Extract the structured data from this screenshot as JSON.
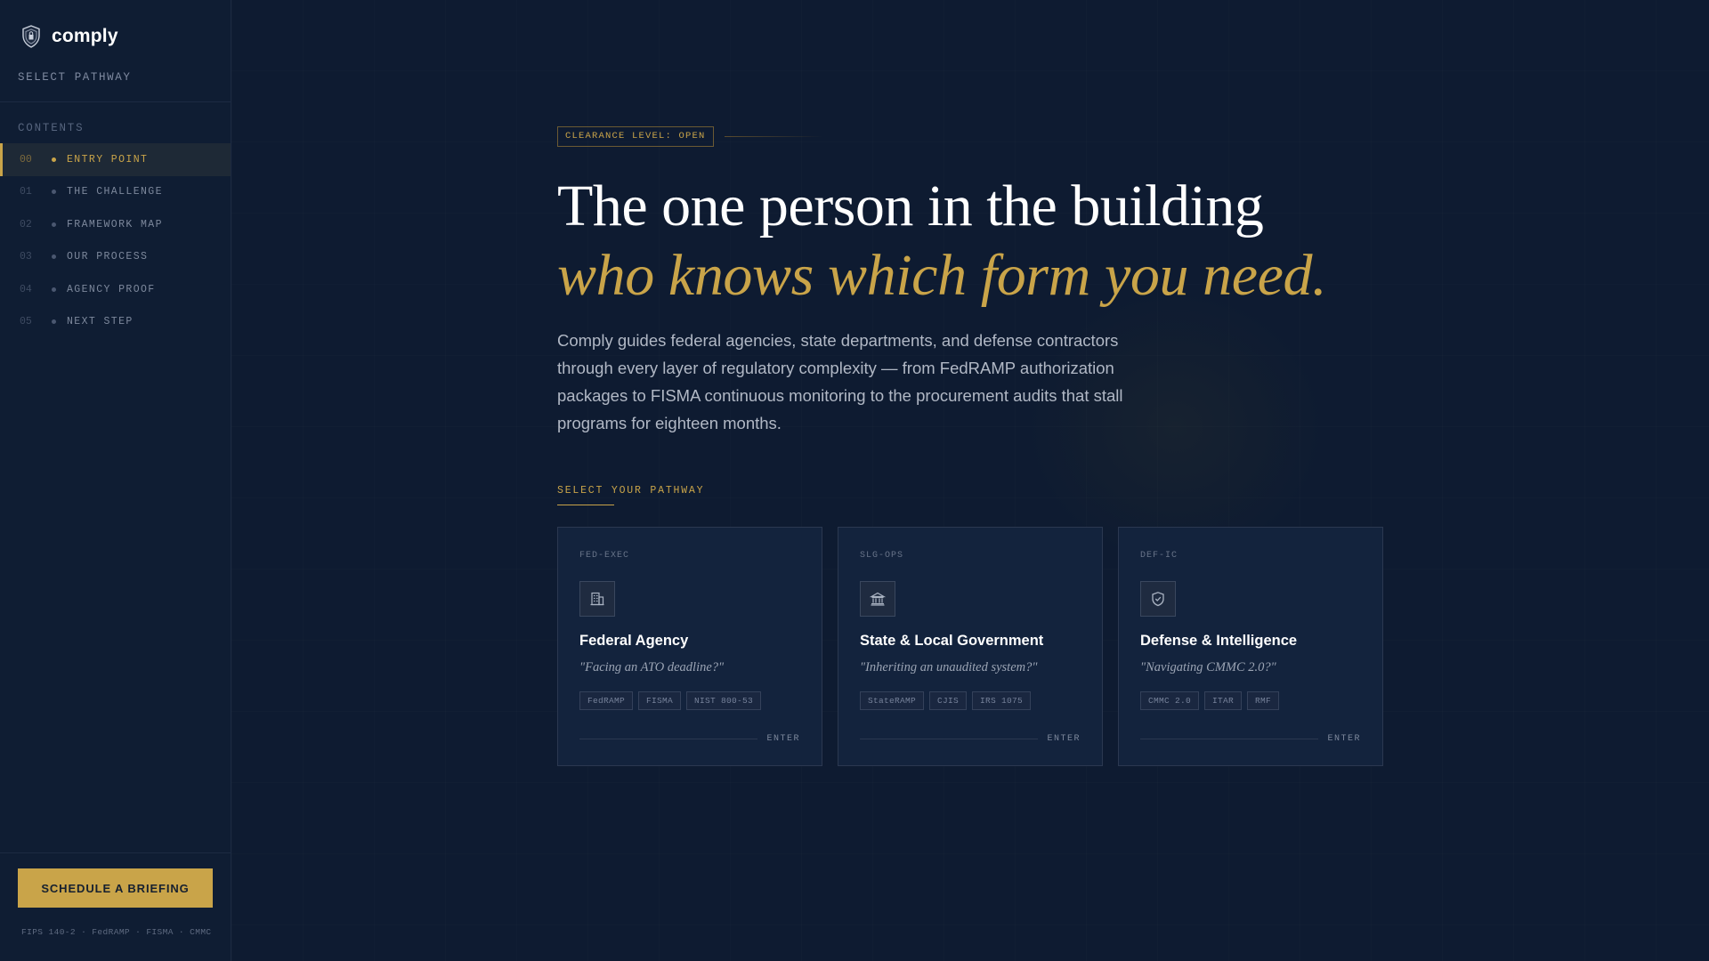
{
  "sidebar": {
    "brand": {
      "name": "comply",
      "logo_icon": "shield-crest-icon"
    },
    "pathway_label": "SELECT PATHWAY",
    "contents_label": "CONTENTS",
    "items": [
      {
        "num": "00",
        "label": "ENTRY POINT",
        "active": true
      },
      {
        "num": "01",
        "label": "THE CHALLENGE",
        "active": false
      },
      {
        "num": "02",
        "label": "FRAMEWORK MAP",
        "active": false
      },
      {
        "num": "03",
        "label": "OUR PROCESS",
        "active": false
      },
      {
        "num": "04",
        "label": "AGENCY PROOF",
        "active": false
      },
      {
        "num": "05",
        "label": "NEXT STEP",
        "active": false
      }
    ],
    "cta_label": "SCHEDULE A BRIEFING",
    "compliance_footer": "FIPS 140-2 · FedRAMP · FISMA · CMMC"
  },
  "hero": {
    "clearance": "CLEARANCE LEVEL: OPEN",
    "headline": "The one person in the building",
    "headline_accent": "who knows which form you need.",
    "intro": "Comply guides federal agencies, state departments, and defense contractors through every layer of regulatory complexity — from FedRAMP authorization packages to FISMA continuous monitoring to the procurement audits that stall programs for eighteen months.",
    "select_label": "SELECT YOUR PATHWAY"
  },
  "cards": [
    {
      "code": "FED-EXEC",
      "icon": "office-building-icon",
      "title": "Federal Agency",
      "quote": "\"Facing an ATO deadline?\"",
      "tags": [
        "FedRAMP",
        "FISMA",
        "NIST 800-53"
      ],
      "enter": "ENTER"
    },
    {
      "code": "SLG-OPS",
      "icon": "capitol-building-icon",
      "title": "State & Local Government",
      "quote": "\"Inheriting an unaudited system?\"",
      "tags": [
        "StateRAMP",
        "CJIS",
        "IRS 1075"
      ],
      "enter": "ENTER"
    },
    {
      "code": "DEF-IC",
      "icon": "shield-check-icon",
      "title": "Defense & Intelligence",
      "quote": "\"Navigating CMMC 2.0?\"",
      "tags": [
        "CMMC 2.0",
        "ITAR",
        "RMF"
      ],
      "enter": "ENTER"
    }
  ],
  "colors": {
    "background": "#0e1b31",
    "accent_gold": "#c9a449",
    "sidebar_bg": "#0f1d33",
    "card_bg": "#13233d"
  }
}
